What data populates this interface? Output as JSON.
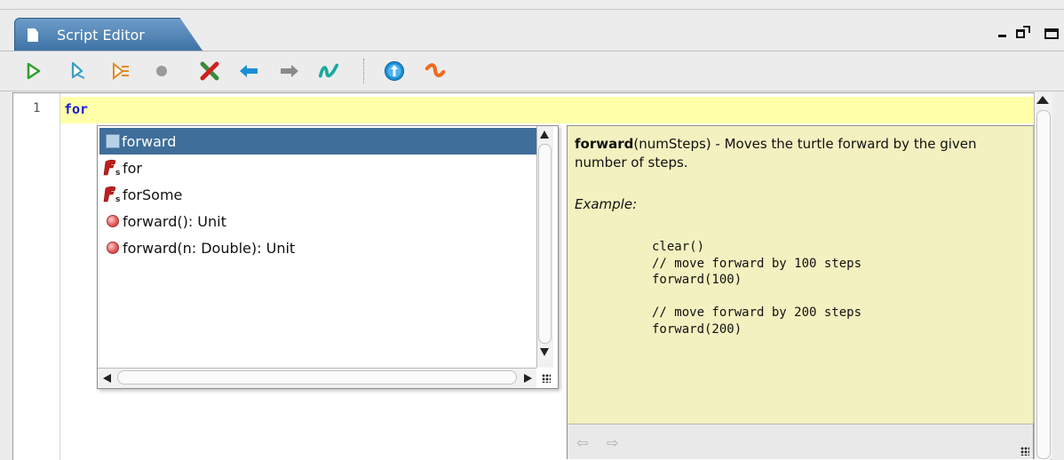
{
  "window": {
    "tab_title": "Script Editor",
    "controls": [
      "minimize-icon",
      "maximize-icon",
      "restore-icon"
    ]
  },
  "toolbar": {
    "buttons": [
      {
        "name": "run-icon",
        "color": "#2e9e2e"
      },
      {
        "name": "run-worksheet-icon",
        "color": "#3aa0c8"
      },
      {
        "name": "trace-icon",
        "color": "#e58a1f"
      },
      {
        "name": "stop-icon",
        "color": "#9a9a9a"
      },
      {
        "name": "clear-output-icon",
        "color": "#3a8a3a"
      },
      {
        "name": "history-back-icon",
        "color": "#1a8fd6"
      },
      {
        "name": "history-forward-icon",
        "color": "#8a8a8a"
      },
      {
        "name": "format-icon",
        "color": "#19a9a0"
      },
      {
        "name": "upload-icon",
        "color": "#1a8fd6"
      },
      {
        "name": "reset-icon",
        "color": "#f06b1d"
      }
    ]
  },
  "editor": {
    "line_number": "1",
    "code": "for",
    "keyword_color": "#1b1bd6",
    "current_line_color": "#ffffaa"
  },
  "completion": {
    "items": [
      {
        "label": "forward",
        "icon": "template-icon",
        "selected": true
      },
      {
        "label": "for",
        "icon": "keyword-template-icon",
        "selected": false
      },
      {
        "label": "forSome",
        "icon": "keyword-template-icon",
        "selected": false
      },
      {
        "label": "forward(): Unit",
        "icon": "method-icon",
        "selected": false
      },
      {
        "label": "forward(n: Double): Unit",
        "icon": "method-icon",
        "selected": false
      }
    ],
    "selection_color": "#3e6e99"
  },
  "doc": {
    "function_name": "forward",
    "description": "(numSteps) - Moves the turtle forward by the given number of steps.",
    "example_label": "Example:",
    "code": "clear()\n// move forward by 100 steps\nforward(100)\n\n// move forward by 200 steps\nforward(200)",
    "nav_back": "⇦",
    "nav_forward": "⇨",
    "background_color": "#f3f1c0"
  }
}
